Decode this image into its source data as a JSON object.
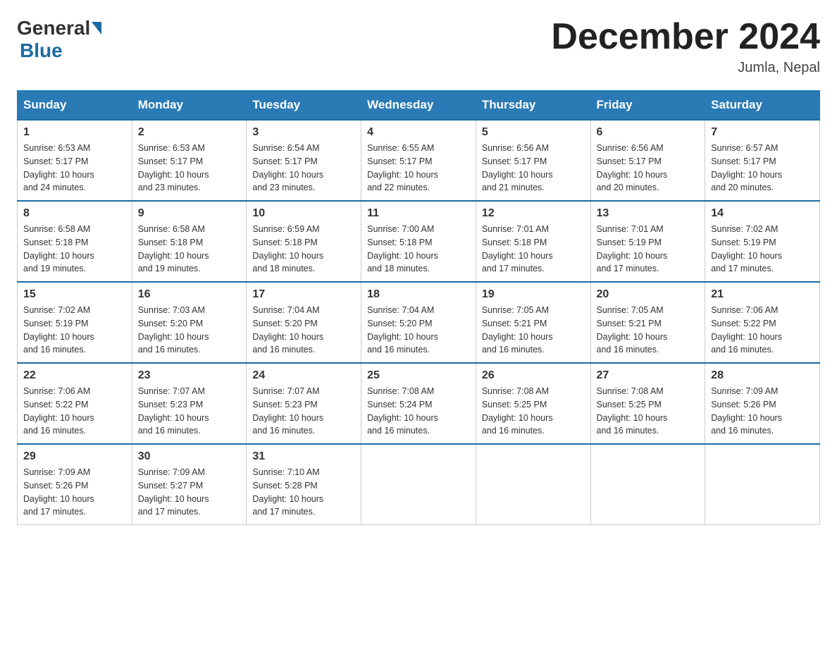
{
  "logo": {
    "general": "General",
    "blue": "Blue"
  },
  "header": {
    "title": "December 2024",
    "location": "Jumla, Nepal"
  },
  "days_of_week": [
    "Sunday",
    "Monday",
    "Tuesday",
    "Wednesday",
    "Thursday",
    "Friday",
    "Saturday"
  ],
  "weeks": [
    [
      {
        "day": "1",
        "sunrise": "6:53 AM",
        "sunset": "5:17 PM",
        "daylight": "10 hours and 24 minutes."
      },
      {
        "day": "2",
        "sunrise": "6:53 AM",
        "sunset": "5:17 PM",
        "daylight": "10 hours and 23 minutes."
      },
      {
        "day": "3",
        "sunrise": "6:54 AM",
        "sunset": "5:17 PM",
        "daylight": "10 hours and 23 minutes."
      },
      {
        "day": "4",
        "sunrise": "6:55 AM",
        "sunset": "5:17 PM",
        "daylight": "10 hours and 22 minutes."
      },
      {
        "day": "5",
        "sunrise": "6:56 AM",
        "sunset": "5:17 PM",
        "daylight": "10 hours and 21 minutes."
      },
      {
        "day": "6",
        "sunrise": "6:56 AM",
        "sunset": "5:17 PM",
        "daylight": "10 hours and 20 minutes."
      },
      {
        "day": "7",
        "sunrise": "6:57 AM",
        "sunset": "5:17 PM",
        "daylight": "10 hours and 20 minutes."
      }
    ],
    [
      {
        "day": "8",
        "sunrise": "6:58 AM",
        "sunset": "5:18 PM",
        "daylight": "10 hours and 19 minutes."
      },
      {
        "day": "9",
        "sunrise": "6:58 AM",
        "sunset": "5:18 PM",
        "daylight": "10 hours and 19 minutes."
      },
      {
        "day": "10",
        "sunrise": "6:59 AM",
        "sunset": "5:18 PM",
        "daylight": "10 hours and 18 minutes."
      },
      {
        "day": "11",
        "sunrise": "7:00 AM",
        "sunset": "5:18 PM",
        "daylight": "10 hours and 18 minutes."
      },
      {
        "day": "12",
        "sunrise": "7:01 AM",
        "sunset": "5:18 PM",
        "daylight": "10 hours and 17 minutes."
      },
      {
        "day": "13",
        "sunrise": "7:01 AM",
        "sunset": "5:19 PM",
        "daylight": "10 hours and 17 minutes."
      },
      {
        "day": "14",
        "sunrise": "7:02 AM",
        "sunset": "5:19 PM",
        "daylight": "10 hours and 17 minutes."
      }
    ],
    [
      {
        "day": "15",
        "sunrise": "7:02 AM",
        "sunset": "5:19 PM",
        "daylight": "10 hours and 16 minutes."
      },
      {
        "day": "16",
        "sunrise": "7:03 AM",
        "sunset": "5:20 PM",
        "daylight": "10 hours and 16 minutes."
      },
      {
        "day": "17",
        "sunrise": "7:04 AM",
        "sunset": "5:20 PM",
        "daylight": "10 hours and 16 minutes."
      },
      {
        "day": "18",
        "sunrise": "7:04 AM",
        "sunset": "5:20 PM",
        "daylight": "10 hours and 16 minutes."
      },
      {
        "day": "19",
        "sunrise": "7:05 AM",
        "sunset": "5:21 PM",
        "daylight": "10 hours and 16 minutes."
      },
      {
        "day": "20",
        "sunrise": "7:05 AM",
        "sunset": "5:21 PM",
        "daylight": "10 hours and 16 minutes."
      },
      {
        "day": "21",
        "sunrise": "7:06 AM",
        "sunset": "5:22 PM",
        "daylight": "10 hours and 16 minutes."
      }
    ],
    [
      {
        "day": "22",
        "sunrise": "7:06 AM",
        "sunset": "5:22 PM",
        "daylight": "10 hours and 16 minutes."
      },
      {
        "day": "23",
        "sunrise": "7:07 AM",
        "sunset": "5:23 PM",
        "daylight": "10 hours and 16 minutes."
      },
      {
        "day": "24",
        "sunrise": "7:07 AM",
        "sunset": "5:23 PM",
        "daylight": "10 hours and 16 minutes."
      },
      {
        "day": "25",
        "sunrise": "7:08 AM",
        "sunset": "5:24 PM",
        "daylight": "10 hours and 16 minutes."
      },
      {
        "day": "26",
        "sunrise": "7:08 AM",
        "sunset": "5:25 PM",
        "daylight": "10 hours and 16 minutes."
      },
      {
        "day": "27",
        "sunrise": "7:08 AM",
        "sunset": "5:25 PM",
        "daylight": "10 hours and 16 minutes."
      },
      {
        "day": "28",
        "sunrise": "7:09 AM",
        "sunset": "5:26 PM",
        "daylight": "10 hours and 16 minutes."
      }
    ],
    [
      {
        "day": "29",
        "sunrise": "7:09 AM",
        "sunset": "5:26 PM",
        "daylight": "10 hours and 17 minutes."
      },
      {
        "day": "30",
        "sunrise": "7:09 AM",
        "sunset": "5:27 PM",
        "daylight": "10 hours and 17 minutes."
      },
      {
        "day": "31",
        "sunrise": "7:10 AM",
        "sunset": "5:28 PM",
        "daylight": "10 hours and 17 minutes."
      },
      null,
      null,
      null,
      null
    ]
  ],
  "labels": {
    "sunrise": "Sunrise:",
    "sunset": "Sunset:",
    "daylight": "Daylight:"
  }
}
